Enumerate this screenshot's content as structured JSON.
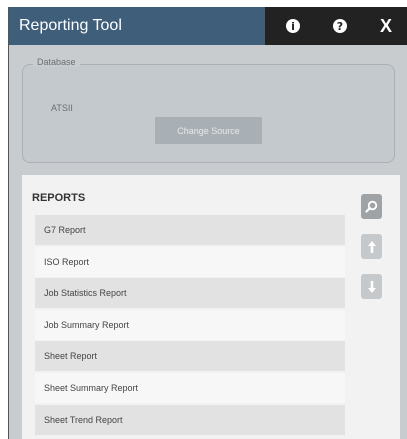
{
  "window": {
    "title": "Reporting Tool"
  },
  "titlebar": {
    "info_glyph": "i",
    "help_glyph": "?",
    "close_label": "X"
  },
  "database": {
    "legend": "Database",
    "name": "ATSII",
    "change_button": "Change Source"
  },
  "reports": {
    "title": "REPORTS",
    "items": [
      {
        "label": "G7 Report"
      },
      {
        "label": "ISO Report"
      },
      {
        "label": "Job Statistics Report"
      },
      {
        "label": "Job Summary Report"
      },
      {
        "label": "Sheet Report"
      },
      {
        "label": "Sheet Summary Report"
      },
      {
        "label": "Sheet Trend Report"
      }
    ]
  },
  "colors": {
    "titlebar": "#3e5e7a",
    "titlebar_dark": "#222222",
    "panel": "#c8cccf",
    "list_bg": "#f2f2f2"
  },
  "icons": {
    "info": "info-icon",
    "help": "help-icon",
    "close": "close-icon",
    "search": "search-icon",
    "up": "arrow-up-icon",
    "down": "arrow-down-icon"
  }
}
